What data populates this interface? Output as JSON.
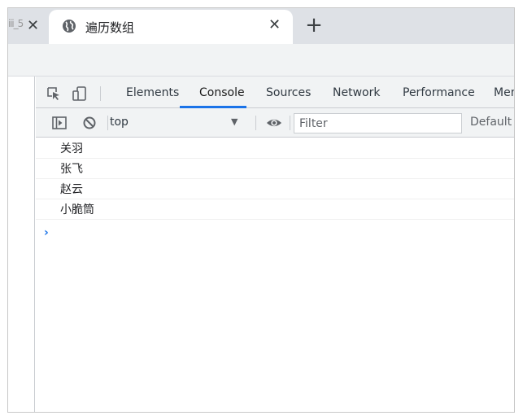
{
  "tabs": {
    "previous_fragment": "ⅲ_5",
    "active_title": "遍历数组",
    "close_glyph": "✕",
    "new_tab_glyph": "+"
  },
  "devtools": {
    "tabs": [
      "Elements",
      "Console",
      "Sources",
      "Network",
      "Performance",
      "Mem"
    ],
    "active_tab": "Console",
    "context": "top",
    "filter_placeholder": "Filter",
    "levels_label": "Default l",
    "accent_color": "#1a73e8"
  },
  "console": {
    "logs": [
      "关羽",
      "张飞",
      "赵云",
      "小脆筒"
    ],
    "prompt_glyph": "›"
  }
}
